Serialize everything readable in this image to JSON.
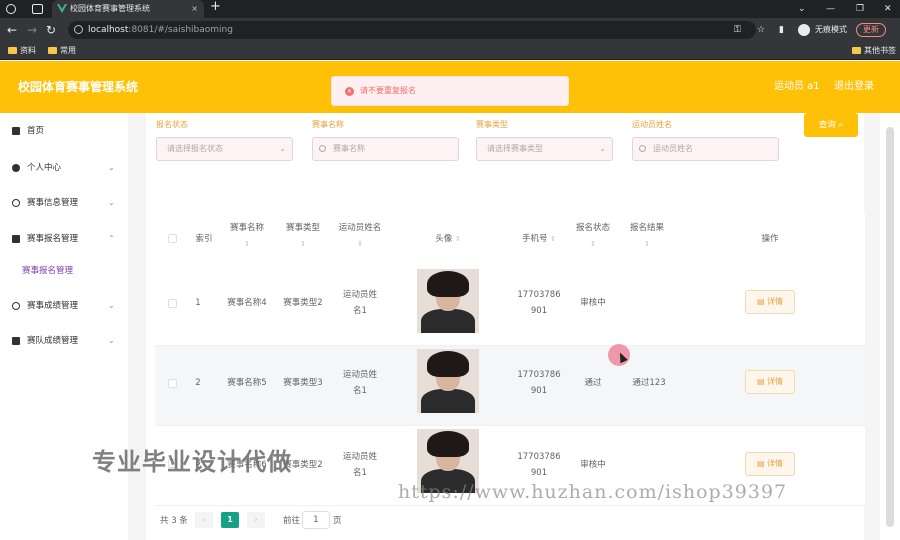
{
  "browser": {
    "tab_title": "校园体育赛事管理系统",
    "tab_close": "×",
    "new_tab": "+",
    "url_host": "localhost",
    "url_path": ":8081/#/saishibaoming",
    "incognito_label": "无痕模式",
    "update_label": "更新",
    "bookmarks": [
      "资料",
      "常用"
    ],
    "other_bookmarks": "其他书签",
    "window_controls": [
      "⌄",
      "—",
      "❐",
      "✕"
    ]
  },
  "header": {
    "title": "校园体育赛事管理系统",
    "user": "运动员 a1",
    "logout": "退出登录"
  },
  "toast": {
    "message": "请不要重复报名",
    "color": "#f56c6c"
  },
  "sidebar": {
    "items": [
      {
        "label": "首页",
        "icon": "home-icon"
      },
      {
        "label": "个人中心",
        "icon": "user-icon"
      },
      {
        "label": "赛事信息管理",
        "icon": "compass-icon"
      },
      {
        "label": "赛事报名管理",
        "icon": "document-icon"
      },
      {
        "label": "赛事成绩管理",
        "icon": "clock-icon"
      },
      {
        "label": "赛队成绩管理",
        "icon": "clipboard-icon"
      }
    ],
    "sub_active": "赛事报名管理"
  },
  "filters": {
    "status_label": "报名状态",
    "status_placeholder": "请选择报名状态",
    "name_label": "赛事名称",
    "name_placeholder": "赛事名称",
    "type_label": "赛事类型",
    "type_placeholder": "请选择赛事类型",
    "athlete_label": "运动员姓名",
    "athlete_placeholder": "运动员姓名",
    "query_button": "查询"
  },
  "table": {
    "headers": {
      "index": "索引",
      "event_name": "赛事名称",
      "event_type": "赛事类型",
      "athlete": "运动员姓名",
      "avatar": "头像",
      "phone": "手机号",
      "status": "报名状态",
      "result": "报名结果",
      "action": "操作"
    },
    "rows": [
      {
        "index": "1",
        "event_name": "赛事名称4",
        "event_type": "赛事类型2",
        "athlete1": "运动员姓",
        "athlete2": "名1",
        "phone1": "17703786",
        "phone2": "901",
        "status": "审核中",
        "result": "",
        "action": "详情"
      },
      {
        "index": "2",
        "event_name": "赛事名称5",
        "event_type": "赛事类型3",
        "athlete1": "运动员姓",
        "athlete2": "名1",
        "phone1": "17703786",
        "phone2": "901",
        "status": "通过",
        "result": "通过123",
        "action": "详情"
      },
      {
        "index": "3",
        "event_name": "赛事名称6",
        "event_type": "赛事类型2",
        "athlete1": "运动员姓",
        "athlete2": "名1",
        "phone1": "17703786",
        "phone2": "901",
        "status": "审核中",
        "result": "",
        "action": "详情"
      }
    ]
  },
  "pagination": {
    "total": "共 3 条",
    "prev": "‹",
    "current": "1",
    "next": "›",
    "goto": "前往",
    "page_value": "1",
    "page_unit": "页"
  },
  "watermark": {
    "text1": "专业毕业设计代做",
    "text2": "https://www.huzhan.com/ishop39397"
  },
  "colors": {
    "accent": "#ffc107",
    "active_page": "#16a085",
    "sub_menu": "#7b3fb6"
  }
}
